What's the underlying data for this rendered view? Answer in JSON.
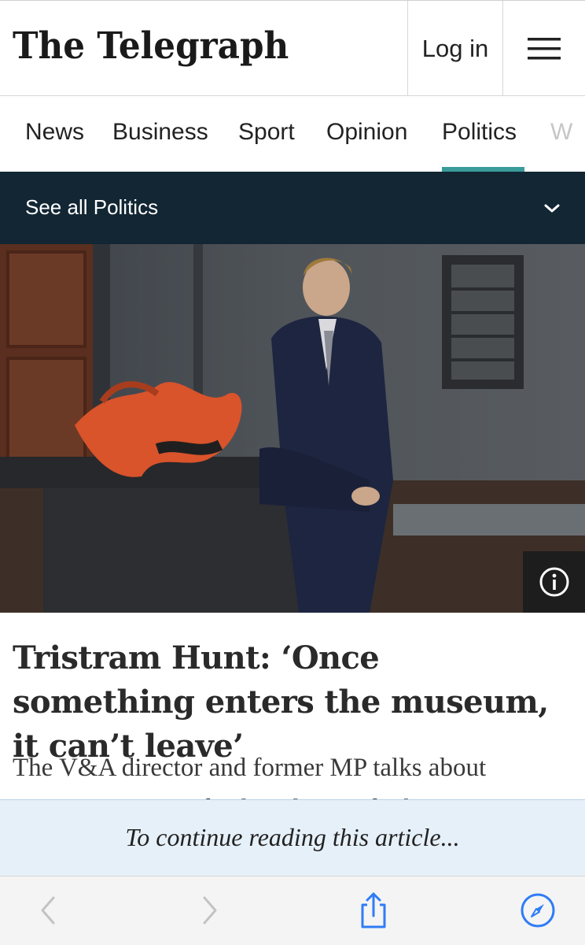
{
  "header": {
    "logo_text": "The Telegraph",
    "login_label": "Log in",
    "menu_icon": "hamburger-menu-icon"
  },
  "nav": {
    "items": [
      {
        "label": "News"
      },
      {
        "label": "Business"
      },
      {
        "label": "Sport"
      },
      {
        "label": "Opinion"
      },
      {
        "label": "Politics",
        "active": true
      },
      {
        "label": "W"
      }
    ]
  },
  "subnav": {
    "label": "See all Politics",
    "icon": "chevron-down-icon"
  },
  "hero": {
    "icon": "info-icon"
  },
  "article": {
    "headline": "Tristram Hunt: ‘Once something enters the museum, it can’t leave’",
    "standfirst": "The V&A director and former MP talks about",
    "standfirst_line2": "restoring statues of colonialists and why"
  },
  "paywall": {
    "text": "To continue reading this article..."
  },
  "browser_toolbar": {
    "back_icon": "back-arrow-icon",
    "forward_icon": "forward-arrow-icon",
    "share_icon": "share-icon",
    "compass_icon": "compass-icon"
  },
  "colors": {
    "accent": "#3a9b9b",
    "subnav_bg": "#122633",
    "paywall_bg": "#e6f0f9",
    "ios_blue": "#2f7cf6"
  }
}
